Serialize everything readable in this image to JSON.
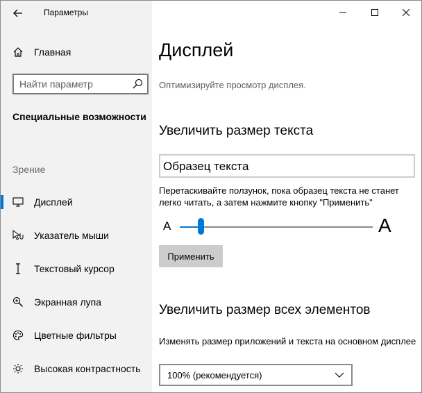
{
  "window": {
    "title": "Параметры"
  },
  "sidebar": {
    "home_label": "Главная",
    "search_placeholder": "Найти параметр",
    "section_heading": "Специальные возможности",
    "group_label": "Зрение",
    "items": [
      {
        "label": "Дисплей",
        "icon": "monitor-icon",
        "active": true
      },
      {
        "label": "Указатель мыши",
        "icon": "mouse-pointer-icon",
        "active": false
      },
      {
        "label": "Текстовый курсор",
        "icon": "text-cursor-icon",
        "active": false
      },
      {
        "label": "Экранная лупа",
        "icon": "magnifier-icon",
        "active": false
      },
      {
        "label": "Цветные фильтры",
        "icon": "color-palette-icon",
        "active": false
      },
      {
        "label": "Высокая контрастность",
        "icon": "brightness-icon",
        "active": false
      }
    ]
  },
  "main": {
    "title": "Дисплей",
    "subtitle": "Оптимизируйте просмотр дисплея.",
    "text_size": {
      "heading": "Увеличить размер текста",
      "sample_text": "Образец текста",
      "description": "Перетаскивайте ползунок, пока образец текста не станет легко читать, а затем нажмите кнопку \"Применить\"",
      "slider_min_label": "A",
      "slider_max_label": "A",
      "slider_value_fraction": 0.11,
      "apply_label": "Применить"
    },
    "scale": {
      "heading": "Увеличить размер всех элементов",
      "description": "Изменять размер приложений и текста на основном дисплее",
      "selected_option": "100% (рекомендуется)"
    }
  },
  "colors": {
    "accent": "#0078d7",
    "sidebar_bg": "#f2f2f2",
    "button_bg": "#cccccc"
  }
}
